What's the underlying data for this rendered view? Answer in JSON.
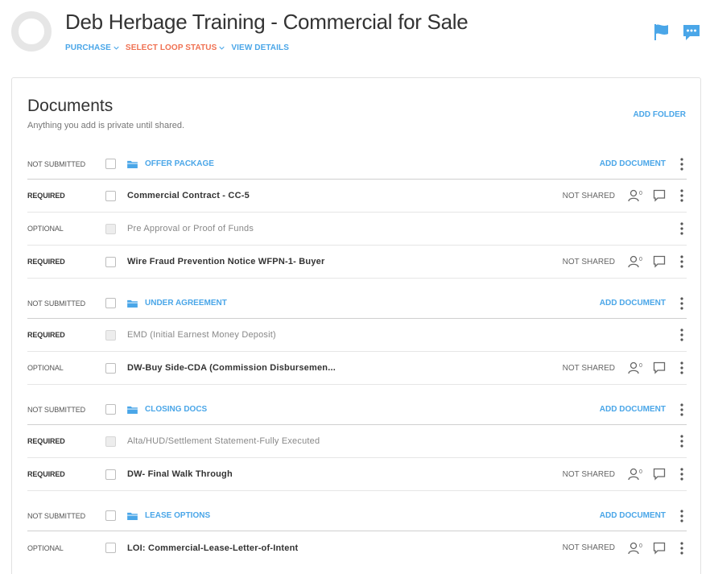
{
  "header": {
    "title": "Deb Herbage Training - Commercial for Sale",
    "nav": {
      "purchase": "PURCHASE",
      "loop_status": "SELECT LOOP STATUS",
      "view_details": "VIEW DETAILS"
    },
    "icons": {
      "flag": "flag-icon",
      "chat": "chat-icon"
    },
    "colors": {
      "accent": "#4aa6e8",
      "status_orange": "#f07152"
    }
  },
  "documents": {
    "title": "Documents",
    "subtitle": "Anything you add is private until shared.",
    "add_folder": "ADD FOLDER",
    "rows": [
      {
        "type": "folder",
        "status": "NOT SUBMITTED",
        "name": "OFFER PACKAGE",
        "action": "ADD DOCUMENT"
      },
      {
        "type": "doc",
        "status": "REQUIRED",
        "name": "Commercial Contract - CC-5",
        "share": "NOT SHARED"
      },
      {
        "type": "doc",
        "status": "OPTIONAL",
        "name": "Pre Approval or Proof of Funds",
        "share": ""
      },
      {
        "type": "doc",
        "status": "REQUIRED",
        "name": "Wire Fraud Prevention Notice WFPN-1- Buyer",
        "share": "NOT SHARED"
      },
      {
        "type": "folder",
        "status": "NOT SUBMITTED",
        "name": "UNDER AGREEMENT",
        "action": "ADD DOCUMENT"
      },
      {
        "type": "doc",
        "status": "REQUIRED",
        "name": "EMD (Initial Earnest Money Deposit)",
        "share": ""
      },
      {
        "type": "doc",
        "status": "OPTIONAL",
        "name": "DW-Buy Side-CDA (Commission Disbursemen...",
        "share": "NOT SHARED"
      },
      {
        "type": "folder",
        "status": "NOT SUBMITTED",
        "name": "CLOSING DOCS",
        "action": "ADD DOCUMENT"
      },
      {
        "type": "doc",
        "status": "REQUIRED",
        "name": "Alta/HUD/Settlement Statement-Fully Executed",
        "share": ""
      },
      {
        "type": "doc",
        "status": "REQUIRED",
        "name": "DW- Final Walk Through",
        "share": "NOT SHARED"
      },
      {
        "type": "folder",
        "status": "NOT SUBMITTED",
        "name": "LEASE OPTIONS",
        "action": "ADD DOCUMENT"
      },
      {
        "type": "doc",
        "status": "OPTIONAL",
        "name": "LOI: Commercial-Lease-Letter-of-Intent",
        "share": "NOT SHARED"
      }
    ]
  }
}
